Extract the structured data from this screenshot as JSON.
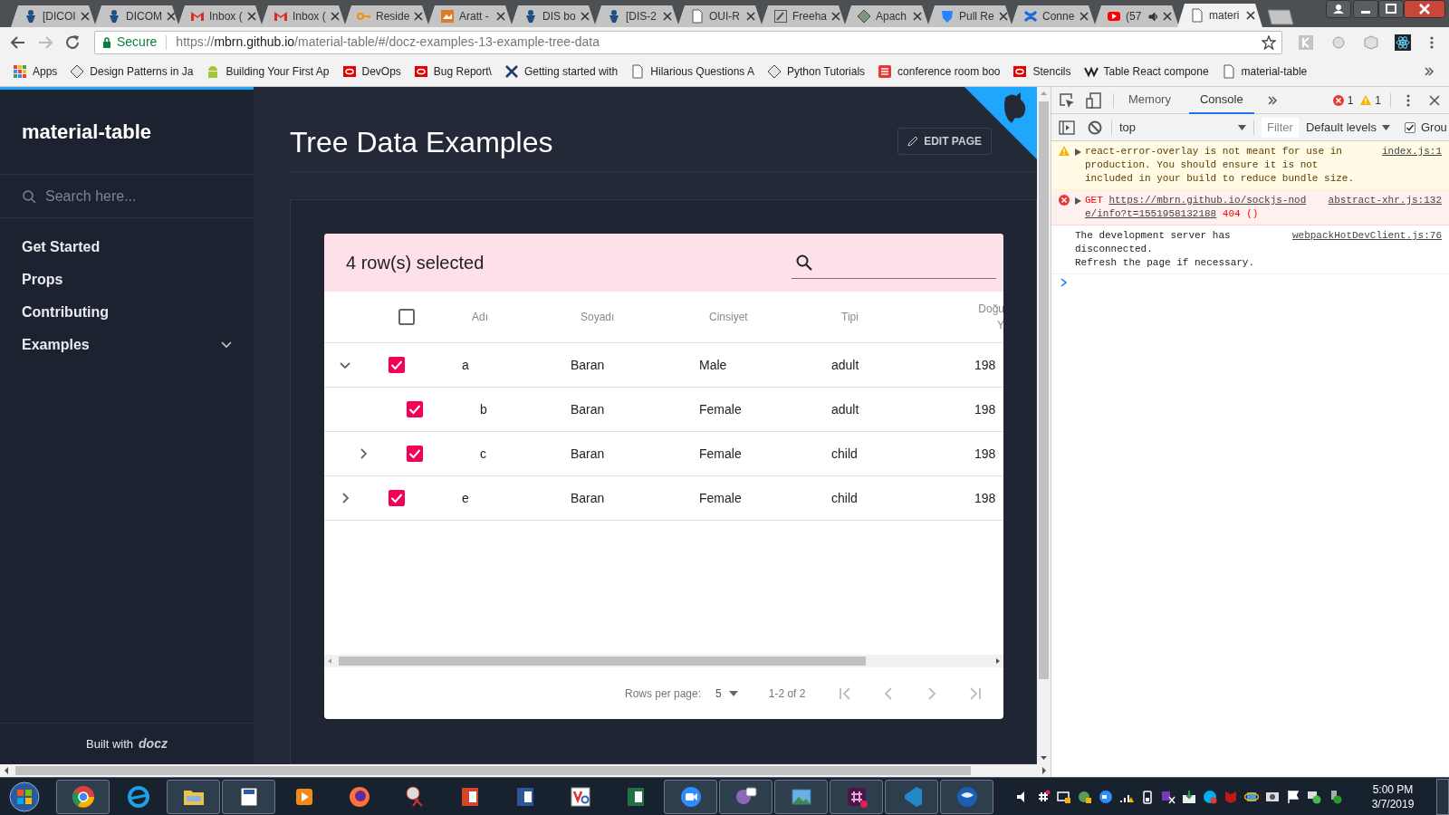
{
  "browser": {
    "tabs": [
      {
        "title": "[DICOI",
        "selected": false,
        "audio": false
      },
      {
        "title": "DICOM",
        "selected": false,
        "audio": false
      },
      {
        "title": "Inbox (",
        "selected": false,
        "audio": false
      },
      {
        "title": "Inbox (",
        "selected": false,
        "audio": false
      },
      {
        "title": "Reside",
        "selected": false,
        "audio": false
      },
      {
        "title": "Aratt -",
        "selected": false,
        "audio": false
      },
      {
        "title": "DIS bo",
        "selected": false,
        "audio": false
      },
      {
        "title": "[DIS-2",
        "selected": false,
        "audio": false
      },
      {
        "title": "OUI-R",
        "selected": false,
        "audio": false
      },
      {
        "title": "Freeha",
        "selected": false,
        "audio": false
      },
      {
        "title": "Apach",
        "selected": false,
        "audio": false
      },
      {
        "title": "Pull Re",
        "selected": false,
        "audio": false
      },
      {
        "title": "Conne",
        "selected": false,
        "audio": false
      },
      {
        "title": "(57",
        "selected": false,
        "audio": true
      },
      {
        "title": "materi",
        "selected": true,
        "audio": false
      }
    ],
    "address_bar": {
      "security": "Secure",
      "url_scheme": "https://",
      "url_host": "mbrn.github.io",
      "url_path": "/material-table/#/docz-examples-13-example-tree-data"
    },
    "bookmarks": [
      "Apps",
      "Design Patterns in Ja",
      "Building Your First Ap",
      "DevOps",
      "Bug Report\\",
      "Getting started with",
      "Hilarious Questions A",
      "Python Tutorials",
      "conference room boo",
      "Stencils",
      "Table React compone",
      "material-table"
    ]
  },
  "sidebar": {
    "title": "material-table",
    "search_placeholder": "Search here...",
    "nav": [
      {
        "label": "Get Started",
        "expandable": false
      },
      {
        "label": "Props",
        "expandable": false
      },
      {
        "label": "Contributing",
        "expandable": false
      },
      {
        "label": "Examples",
        "expandable": true
      }
    ],
    "footer": "Built with",
    "footer_logo": "docz"
  },
  "page": {
    "title": "Tree Data Examples",
    "edit_button": "EDIT PAGE"
  },
  "table": {
    "toolbar_title": "4 row(s) selected",
    "header_checked": false,
    "columns": [
      {
        "lines": [
          "Adı"
        ]
      },
      {
        "lines": [
          "Soyadı"
        ]
      },
      {
        "lines": [
          "Cinsiyet"
        ]
      },
      {
        "lines": [
          "Tipi"
        ]
      },
      {
        "lines": [
          "Doğu",
          "Y"
        ]
      }
    ],
    "rows": [
      {
        "cells": [
          "a",
          "Baran",
          "Male",
          "adult",
          "198"
        ],
        "checked": true,
        "expandable": true,
        "expanded": true,
        "children": [
          {
            "cells": [
              "b",
              "Baran",
              "Female",
              "adult",
              "198"
            ],
            "checked": true,
            "expandable": false,
            "expanded": false
          },
          {
            "cells": [
              "c",
              "Baran",
              "Female",
              "child",
              "198"
            ],
            "checked": true,
            "expandable": true,
            "expanded": false
          }
        ]
      },
      {
        "cells": [
          "e",
          "Baran",
          "Female",
          "child",
          "198"
        ],
        "checked": true,
        "expandable": true,
        "expanded": false
      }
    ],
    "pagination": {
      "rows_per_page_label": "Rows per page:",
      "rows_per_page": "5",
      "range": "1-2 of 2"
    }
  },
  "devtools": {
    "tabs": [
      {
        "label": "Memory",
        "selected": false
      },
      {
        "label": "Console",
        "selected": true
      }
    ],
    "error_count": "1",
    "warning_count": "1",
    "context": "top",
    "filter_placeholder": "Filter",
    "levels": "Default levels",
    "group_checkbox": {
      "label": "Grou",
      "checked": true
    },
    "messages": [
      {
        "kind": "warning",
        "text": "react-error-overlay is not meant for use in production. You should ensure it is not included in your build to reduce bundle size.",
        "source": "index.js:1"
      },
      {
        "kind": "error",
        "method": "GET",
        "url": "https://mbrn.github.io/sockjs-node/info?t=1551958132188",
        "status": "404 ()",
        "source": "abstract-xhr.js:132"
      },
      {
        "kind": "info",
        "lines": [
          "The development server has disconnected.",
          "Refresh the page if necessary."
        ],
        "source": "webpackHotDevClient.js:76"
      }
    ]
  },
  "taskbar": {
    "time": "5:00 PM",
    "date": "3/7/2019"
  }
}
